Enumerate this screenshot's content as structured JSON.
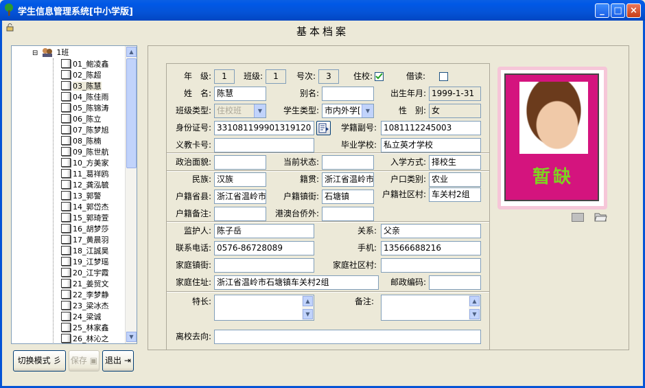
{
  "window": {
    "title": "学生信息管理系统[中小学版]",
    "form_title": "基本档案"
  },
  "tree": {
    "root": "1班",
    "items": [
      "01_鲍凌鑫",
      "02_陈超",
      "03_陈慧",
      "04_陈佳雨",
      "05_陈锦涛",
      "06_陈立",
      "07_陈梦旭",
      "08_陈楠",
      "09_陈世航",
      "10_方美家",
      "11_葛祥鸥",
      "12_龚泓毓",
      "13_郭警",
      "14_郭岱杰",
      "15_郭琦萱",
      "16_胡梦莎",
      "17_黄晨羽",
      "18_江誠昊",
      "19_江梦瑶",
      "20_江宇霞",
      "21_姜贸文",
      "22_李梦静",
      "23_梁冰杰",
      "24_梁诚",
      "25_林家鑫",
      "26_林沁之"
    ],
    "selected_index": 2
  },
  "buttons": {
    "switch_mode": "切换模式",
    "save": "保存",
    "exit": "退出"
  },
  "form": {
    "labels": {
      "grade": "年　级:",
      "class": "班级:",
      "number": "号次:",
      "boarding": "住校:",
      "day": "借读:",
      "name": "姓　名:",
      "alias": "别名:",
      "birth": "出生年月:",
      "class_type": "班级类型:",
      "student_type": "学生类型:",
      "gender": "性　别:",
      "id_no": "身份证号:",
      "reg_no": "学籍副号:",
      "compulsory": "义教卡号:",
      "grad_school": "毕业学校:",
      "political": "政治面貌:",
      "status": "当前状态:",
      "enroll": "入学方式:",
      "nation": "民族:",
      "native": "籍贯:",
      "hukou_type": "户口类别:",
      "hukou_county": "户籍省县:",
      "hukou_town": "户籍镇街:",
      "hukou_village": "户籍社区村:",
      "hukou_note": "户籍备注:",
      "overseas": "港澳台侨外:",
      "guardian": "监护人:",
      "relation": "关系:",
      "phone": "联系电话:",
      "mobile": "手机:",
      "home_town": "家庭镇街:",
      "home_village": "家庭社区村:",
      "address": "家庭住址:",
      "postcode": "邮政编码:",
      "specialty": "特长:",
      "remark": "备注:",
      "leave": "离校去向:"
    },
    "values": {
      "grade": "1",
      "class": "1",
      "number": "3",
      "boarding_checked": true,
      "day_checked": false,
      "name": "陈慧",
      "alias": "",
      "birth": "1999-1-31",
      "class_type": "住校班",
      "student_type": "市内外学[",
      "gender": "女",
      "id_no": "331081199901319120",
      "reg_no": "1081112245003",
      "compulsory": "",
      "grad_school": "私立英才学校",
      "political": "",
      "status": "",
      "enroll": "择校生",
      "nation": "汉族",
      "native": "浙江省温岭市",
      "hukou_type": "农业",
      "hukou_county": "浙江省温岭市",
      "hukou_town": "石塘镇",
      "hukou_village": "车关村2组",
      "hukou_note": "",
      "overseas": "",
      "guardian": "陈子岳",
      "relation": "父亲",
      "phone": "0576-86728089",
      "mobile": "13566688216",
      "home_town": "",
      "home_village": "",
      "address": "浙江省温岭市石塘镇车关村2组",
      "postcode": "",
      "specialty": "",
      "remark": "",
      "leave": ""
    }
  },
  "photo": {
    "placeholder_text": "暂缺"
  }
}
